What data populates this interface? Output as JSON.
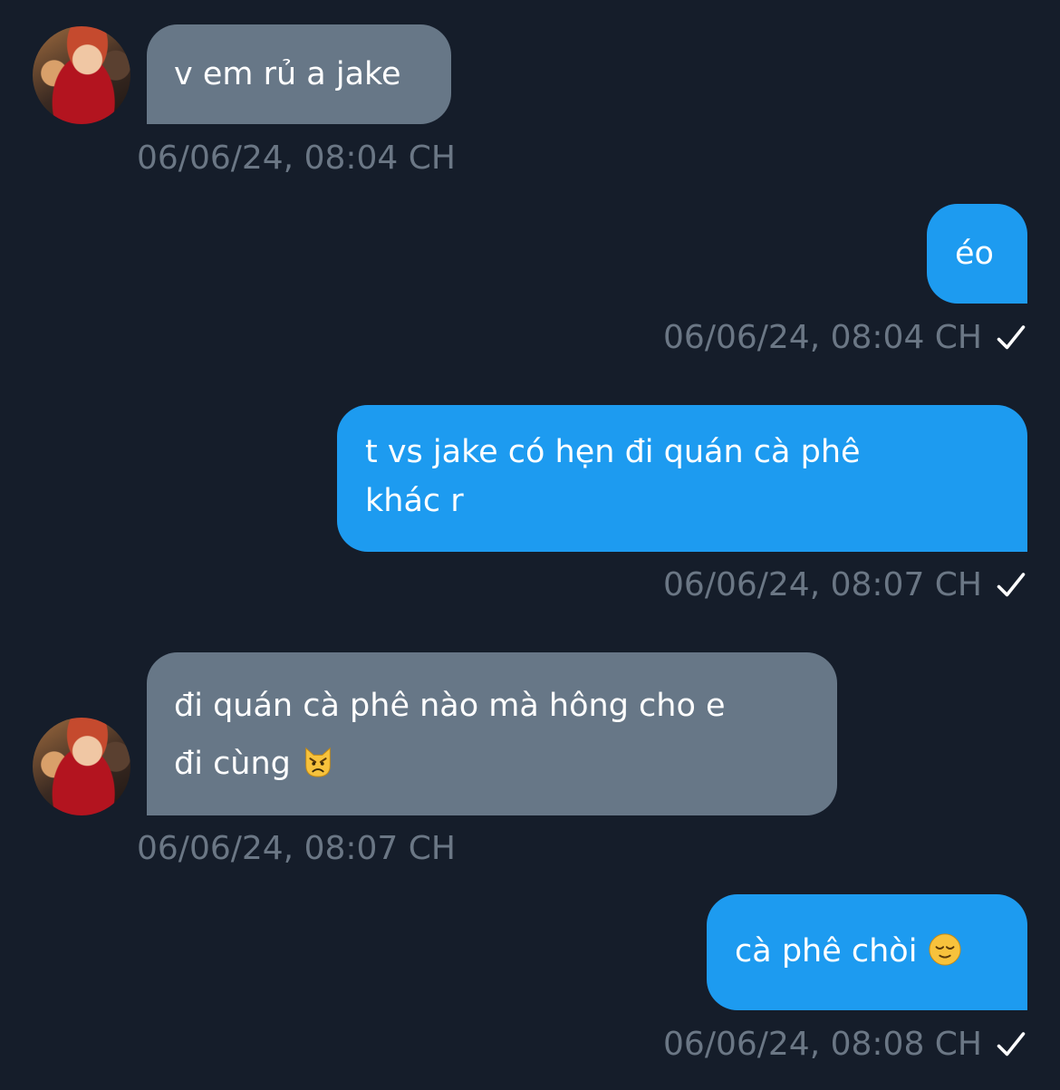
{
  "messages": [
    {
      "direction": "in",
      "text": "v em rủ a jake",
      "time": "06/06/24, 08:04 CH"
    },
    {
      "direction": "out",
      "text": "éo",
      "time": "06/06/24, 08:04 CH",
      "status_icon": "check-icon"
    },
    {
      "direction": "out",
      "line1": "t vs jake có hẹn đi quán cà phê",
      "line2": "khác r",
      "time": "06/06/24, 08:07 CH",
      "status_icon": "check-icon"
    },
    {
      "direction": "in",
      "line1": "đi quán cà phê nào mà hông cho e",
      "line2": "đi cùng",
      "emoji": "pouting-cat-emoji",
      "time": "06/06/24, 08:07 CH"
    },
    {
      "direction": "out",
      "text": "cà phê chòi",
      "emoji": "relieved-face-emoji",
      "time": "06/06/24, 08:08 CH",
      "status_icon": "check-icon"
    }
  ],
  "colors": {
    "background": "#151d2a",
    "incoming_bubble": "#677787",
    "outgoing_bubble": "#1d9bf0",
    "timestamp": "#6b7785"
  }
}
